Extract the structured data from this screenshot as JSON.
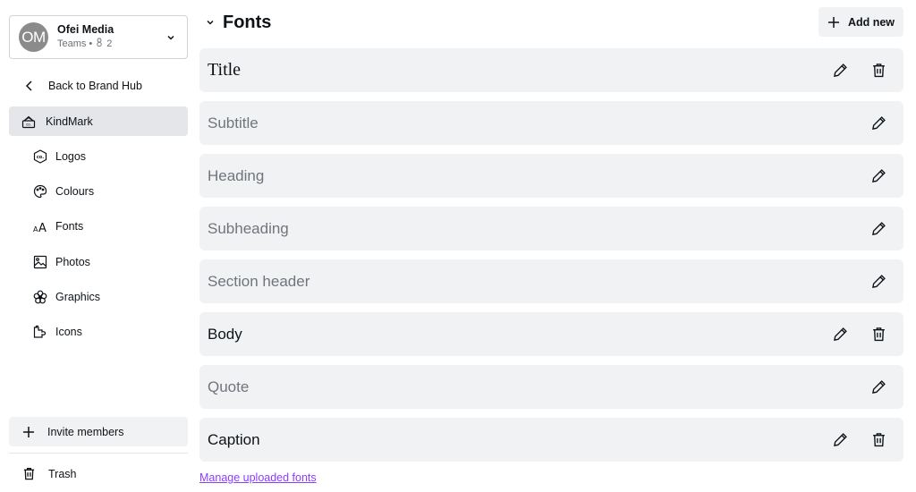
{
  "team": {
    "avatar_initials": "OM",
    "name": "Ofei Media",
    "plan": "Teams",
    "separator": "•",
    "member_count": "2"
  },
  "sidebar": {
    "back_label": "Back to Brand Hub",
    "brand_kit": {
      "label": "KindMark",
      "icon": "brand-kit-icon"
    },
    "items": [
      {
        "label": "Logos",
        "icon": "logo-icon"
      },
      {
        "label": "Colours",
        "icon": "palette-icon"
      },
      {
        "label": "Fonts",
        "icon": "font-icon"
      },
      {
        "label": "Photos",
        "icon": "photo-icon"
      },
      {
        "label": "Graphics",
        "icon": "graphics-icon"
      },
      {
        "label": "Icons",
        "icon": "puzzle-icon"
      }
    ],
    "invite_label": "Invite members",
    "trash_label": "Trash"
  },
  "main": {
    "section_title": "Fonts",
    "add_new_label": "Add new",
    "fonts": [
      {
        "label": "Title",
        "style": "set",
        "deletable": true
      },
      {
        "label": "Subtitle",
        "style": "unset",
        "deletable": false
      },
      {
        "label": "Heading",
        "style": "unset",
        "deletable": false
      },
      {
        "label": "Subheading",
        "style": "unset",
        "deletable": false
      },
      {
        "label": "Section header",
        "style": "unset",
        "deletable": false
      },
      {
        "label": "Body",
        "style": "set",
        "deletable": true
      },
      {
        "label": "Quote",
        "style": "unset",
        "deletable": false
      },
      {
        "label": "Caption",
        "style": "set",
        "deletable": true
      }
    ],
    "manage_link": "Manage uploaded fonts"
  },
  "colors": {
    "accent_link": "#8b3dff",
    "row_bg": "#f1f2f4",
    "active_nav_bg": "#e4e6ea"
  }
}
